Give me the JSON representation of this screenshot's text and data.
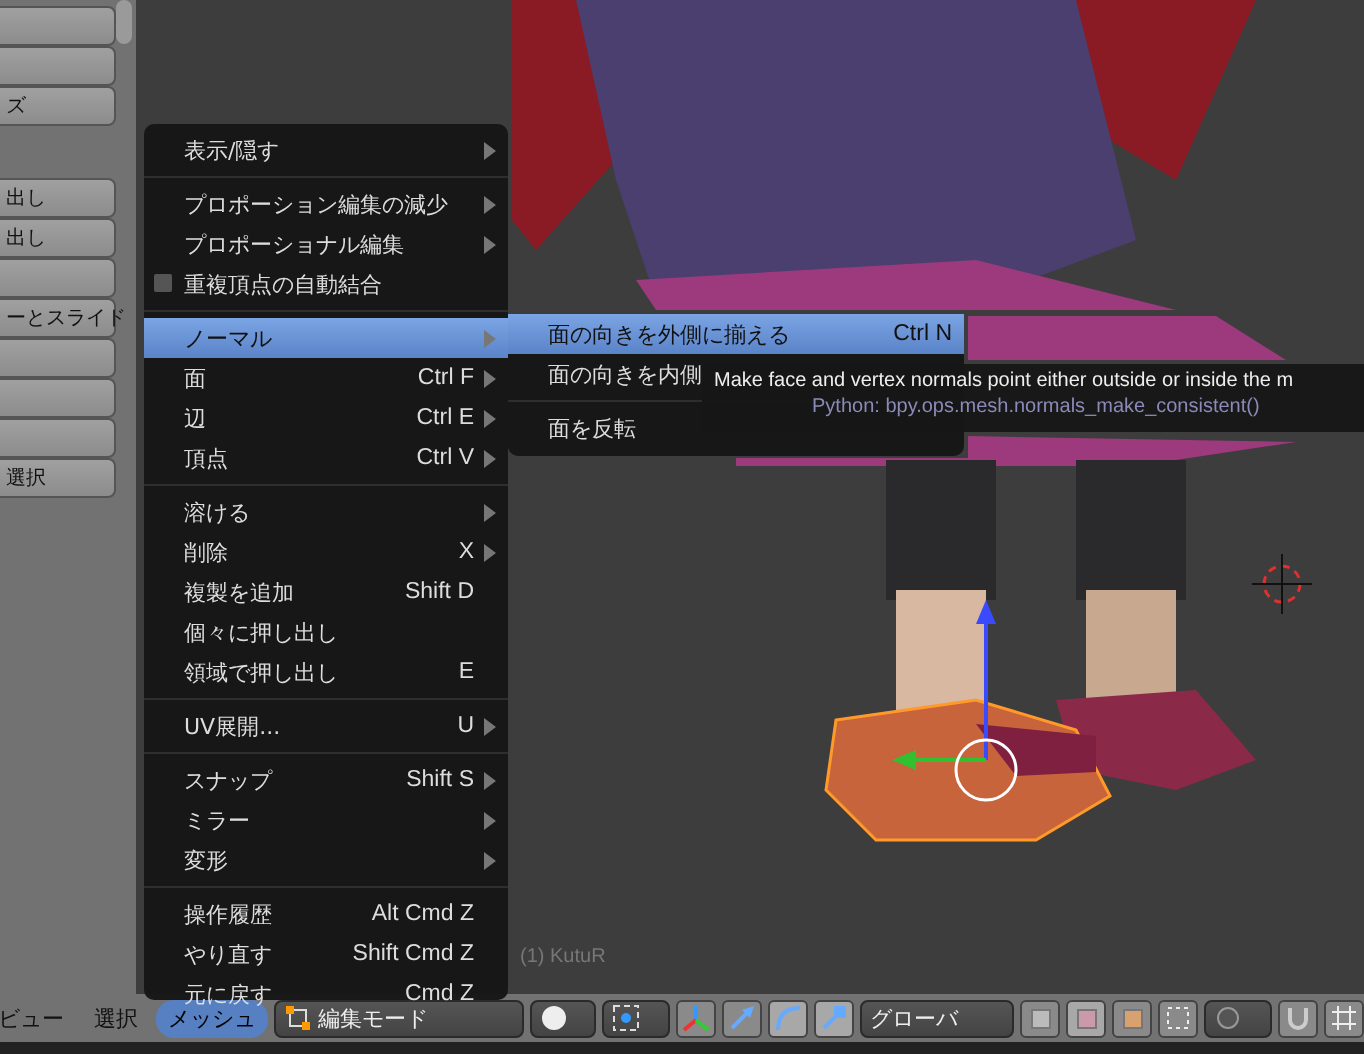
{
  "side_panel": {
    "buttons": [
      {
        "kind": "blank"
      },
      {
        "kind": "blank"
      },
      {
        "kind": "text",
        "label": "ズ"
      },
      {
        "kind": "gap"
      },
      {
        "kind": "text",
        "label": "出し"
      },
      {
        "kind": "text",
        "label": "出し"
      },
      {
        "kind": "blank"
      },
      {
        "kind": "text",
        "label": "ーとスライド"
      },
      {
        "kind": "blank"
      },
      {
        "kind": "blank"
      },
      {
        "kind": "blank"
      },
      {
        "kind": "text",
        "label": "選択"
      }
    ]
  },
  "viewport": {
    "object_label": "(1) KutuR"
  },
  "menu": {
    "items": [
      {
        "kind": "item",
        "label": "表示/隠す",
        "arrow": true,
        "selected": false
      },
      {
        "kind": "separator"
      },
      {
        "kind": "item",
        "label": "プロポーション編集の減少",
        "arrow": true,
        "selected": false
      },
      {
        "kind": "item",
        "label": "プロポーショナル編集",
        "arrow": true,
        "selected": false
      },
      {
        "kind": "check",
        "label": "重複頂点の自動結合",
        "checked": false,
        "selected": false
      },
      {
        "kind": "separator"
      },
      {
        "kind": "item",
        "label": "ノーマル",
        "arrow": true,
        "selected": true
      },
      {
        "kind": "item",
        "label": "面",
        "shortcut": "Ctrl F",
        "arrow": true,
        "selected": false
      },
      {
        "kind": "item",
        "label": "辺",
        "shortcut": "Ctrl E",
        "arrow": true,
        "selected": false
      },
      {
        "kind": "item",
        "label": "頂点",
        "shortcut": "Ctrl V",
        "arrow": true,
        "selected": false
      },
      {
        "kind": "separator"
      },
      {
        "kind": "item",
        "label": "溶ける",
        "arrow": true,
        "selected": false
      },
      {
        "kind": "item",
        "label": "削除",
        "shortcut": "X",
        "arrow": true,
        "selected": false
      },
      {
        "kind": "item",
        "label": "複製を追加",
        "shortcut": "Shift D",
        "arrow": false,
        "selected": false
      },
      {
        "kind": "item",
        "label": "個々に押し出し",
        "arrow": false,
        "selected": false
      },
      {
        "kind": "item",
        "label": "領域で押し出し",
        "shortcut": "E",
        "arrow": false,
        "selected": false
      },
      {
        "kind": "separator"
      },
      {
        "kind": "item",
        "label": "UV展開...",
        "shortcut": "U",
        "arrow": true,
        "selected": false
      },
      {
        "kind": "separator"
      },
      {
        "kind": "item",
        "label": "スナップ",
        "shortcut": "Shift S",
        "arrow": true,
        "selected": false
      },
      {
        "kind": "item",
        "label": "ミラー",
        "arrow": true,
        "selected": false
      },
      {
        "kind": "item",
        "label": "変形",
        "arrow": true,
        "selected": false
      },
      {
        "kind": "separator"
      },
      {
        "kind": "item",
        "label": "操作履歴",
        "shortcut": "Alt Cmd Z",
        "arrow": false,
        "selected": false
      },
      {
        "kind": "item",
        "label": "やり直す",
        "shortcut": "Shift Cmd Z",
        "arrow": false,
        "selected": false
      },
      {
        "kind": "item",
        "label": "元に戻す",
        "shortcut": "Cmd Z",
        "arrow": false,
        "selected": false
      }
    ]
  },
  "submenu": {
    "items": [
      {
        "kind": "item",
        "label": "面の向きを外側に揃える",
        "shortcut": "Ctrl N",
        "selected": true
      },
      {
        "kind": "item",
        "label": "面の向きを内側",
        "selected": false
      },
      {
        "kind": "separator"
      },
      {
        "kind": "item",
        "label": "面を反転",
        "selected": false
      }
    ]
  },
  "tooltip": {
    "description": "Make face and vertex normals point either outside or inside the m",
    "python": "Python: bpy.ops.mesh.normals_make_consistent()"
  },
  "header": {
    "menus": [
      {
        "label": "ビュー",
        "selected": false
      },
      {
        "label": "選択",
        "selected": false
      },
      {
        "label": "メッシュ",
        "selected": true
      }
    ],
    "mode": "編集モード",
    "orientation": "グローバ"
  }
}
